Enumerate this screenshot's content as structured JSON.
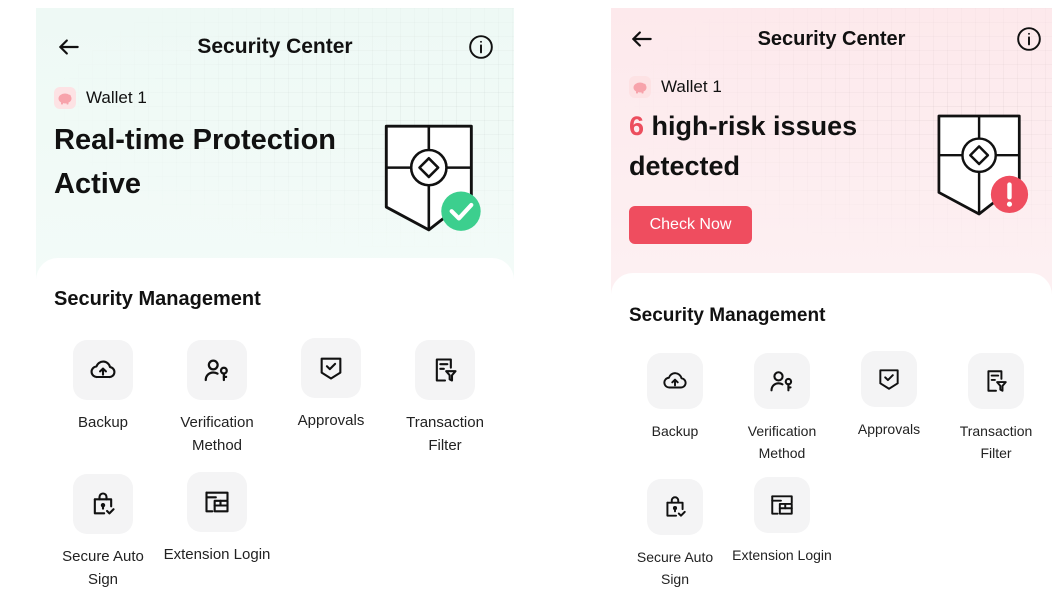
{
  "screens": [
    {
      "nav": {
        "title": "Security Center"
      },
      "wallet": {
        "name": "Wallet 1"
      },
      "headline": {
        "text": "Real-time Protection Active"
      },
      "status": {
        "icon": "check-badge-icon",
        "color": "#3ccf8e"
      },
      "management": {
        "title": "Security Management",
        "items": [
          {
            "label": "Backup",
            "icon": "cloud-upload-icon"
          },
          {
            "label": "Verification Method",
            "icon": "user-key-icon"
          },
          {
            "label": "Approvals",
            "icon": "approval-check-icon"
          },
          {
            "label": "Transaction Filter",
            "icon": "filter-doc-icon"
          },
          {
            "label": "Secure Auto Sign",
            "icon": "lock-bag-icon"
          },
          {
            "label": "Extension Login",
            "icon": "extension-window-icon"
          }
        ]
      }
    },
    {
      "nav": {
        "title": "Security Center"
      },
      "wallet": {
        "name": "Wallet 1"
      },
      "headline": {
        "count": "6",
        "text": " high-risk issues detected"
      },
      "action": {
        "label": "Check Now"
      },
      "status": {
        "icon": "alert-badge-icon",
        "color": "#ef4d5f"
      },
      "management": {
        "title": "Security Management",
        "items": [
          {
            "label": "Backup",
            "icon": "cloud-upload-icon"
          },
          {
            "label": "Verification Method",
            "icon": "user-key-icon"
          },
          {
            "label": "Approvals",
            "icon": "approval-check-icon"
          },
          {
            "label": "Transaction Filter",
            "icon": "filter-doc-icon"
          },
          {
            "label": "Secure Auto Sign",
            "icon": "lock-bag-icon"
          },
          {
            "label": "Extension Login",
            "icon": "extension-window-icon"
          }
        ]
      }
    }
  ],
  "colors": {
    "danger": "#ec4e5e",
    "success": "#3ccf8e",
    "text": "#111111",
    "tile_bg": "#f4f4f5"
  }
}
